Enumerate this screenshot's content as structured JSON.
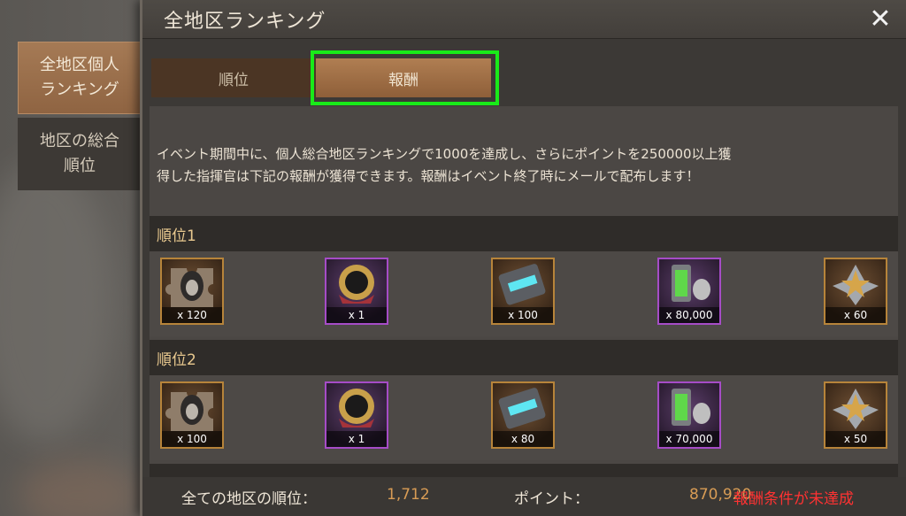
{
  "side_tabs": [
    {
      "label_line1": "全地区個人",
      "label_line2": "ランキング",
      "active": true
    },
    {
      "label_line1": "地区の総合",
      "label_line2": "順位",
      "active": false
    }
  ],
  "panel": {
    "title": "全地区ランキング",
    "close_icon": "close-icon"
  },
  "tabs": {
    "rank": "順位",
    "reward": "報酬",
    "selected": "reward"
  },
  "description": {
    "line1": "イベント期間中に、個人総合地区ランキングで1000を達成し、さらにポイントを250000以上獲",
    "line2": "得した指揮官は下記の報酬が獲得できます。報酬はイベント終了時にメールで配布します！"
  },
  "rewards": [
    {
      "rank_label": "順位1",
      "items": [
        {
          "icon": "hero-shard-icon",
          "qty": "x 120",
          "frame": "gold"
        },
        {
          "icon": "portrait-frame-icon",
          "qty": "x 1",
          "frame": "purple"
        },
        {
          "icon": "speedup-crate-icon",
          "qty": "x 100",
          "frame": "gold"
        },
        {
          "icon": "energy-battery-icon",
          "qty": "x 80,000",
          "frame": "purple"
        },
        {
          "icon": "star-medal-icon",
          "qty": "x 60",
          "frame": "gold"
        }
      ]
    },
    {
      "rank_label": "順位2",
      "items": [
        {
          "icon": "hero-shard-icon",
          "qty": "x 100",
          "frame": "gold"
        },
        {
          "icon": "portrait-frame-icon",
          "qty": "x 1",
          "frame": "purple"
        },
        {
          "icon": "speedup-crate-icon",
          "qty": "x 80",
          "frame": "gold"
        },
        {
          "icon": "energy-battery-icon",
          "qty": "x 70,000",
          "frame": "purple"
        },
        {
          "icon": "star-medal-icon",
          "qty": "x 50",
          "frame": "gold"
        }
      ]
    }
  ],
  "footer": {
    "rank_label": "全ての地区の順位：",
    "rank_value": "1,712",
    "points_label": "ポイント：",
    "points_value": "870,920",
    "status": "報酬条件が未達成"
  },
  "colors": {
    "highlight": "#19ea19",
    "warning": "#ff3232",
    "value": "#d89c55",
    "rank_header": "#e9c98f"
  }
}
